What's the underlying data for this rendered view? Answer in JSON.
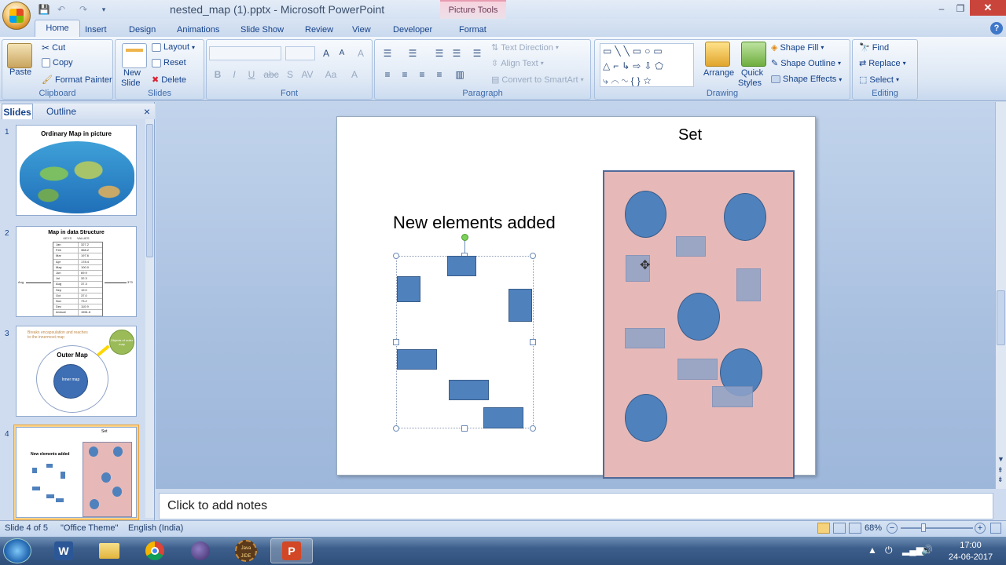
{
  "window": {
    "title": "nested_map (1).pptx - Microsoft PowerPoint",
    "context_tab": "Picture Tools",
    "min": "‒",
    "max": "❐",
    "close": "✕"
  },
  "tabs": [
    "Home",
    "Insert",
    "Design",
    "Animations",
    "Slide Show",
    "Review",
    "View",
    "Developer",
    "Format"
  ],
  "ribbon": {
    "clipboard": {
      "label": "Clipboard",
      "paste": "Paste",
      "cut": "Cut",
      "copy": "Copy",
      "format_painter": "Format Painter"
    },
    "slides": {
      "label": "Slides",
      "new_slide_1": "New",
      "new_slide_2": "Slide",
      "layout": "Layout",
      "reset": "Reset",
      "delete": "Delete"
    },
    "font": {
      "label": "Font",
      "bold": "B",
      "italic": "I",
      "underline": "U",
      "strike": "abc",
      "shadow": "S",
      "spacing": "AV",
      "case": "Aa",
      "grow": "A",
      "shrink": "A",
      "clear": "A"
    },
    "paragraph": {
      "label": "Paragraph",
      "text_direction": "Text Direction",
      "align_text": "Align Text",
      "convert": "Convert to SmartArt"
    },
    "drawing": {
      "label": "Drawing",
      "arrange": "Arrange",
      "quick_styles_1": "Quick",
      "quick_styles_2": "Styles",
      "shape_fill": "Shape Fill",
      "shape_outline": "Shape Outline",
      "shape_effects": "Shape Effects"
    },
    "editing": {
      "label": "Editing",
      "find": "Find",
      "replace": "Replace",
      "select": "Select"
    }
  },
  "panel": {
    "tab_slides": "Slides",
    "tab_outline": "Outline",
    "close": "×"
  },
  "thumbnails": [
    {
      "num": "1",
      "title": "Ordinary Map in picture"
    },
    {
      "num": "2",
      "title": "Map in data Structure",
      "cols": [
        "KEYS",
        "VALUES"
      ],
      "left_label": "Aug",
      "right_label": "373",
      "rows": [
        [
          "Jan",
          "327.2"
        ],
        [
          "Feb",
          "368.2"
        ],
        [
          "Mar",
          "197.6"
        ],
        [
          "Apr",
          "178.4"
        ],
        [
          "May",
          "100.0"
        ],
        [
          "Jun",
          "69.9"
        ],
        [
          "Jul",
          "32.3"
        ],
        [
          "Aug",
          "37.3"
        ],
        [
          "Sep",
          "19.0"
        ],
        [
          "Oct",
          "37.0"
        ],
        [
          "Nov",
          "73.2"
        ],
        [
          "Dec",
          "110.9"
        ],
        [
          "Annual",
          "1551.6"
        ]
      ]
    },
    {
      "num": "3",
      "caption": "Breaks encapsulation and reaches to the innermost map",
      "outer": "Outer Map",
      "inner": "Inner map",
      "bubble": "Objects of outer map"
    },
    {
      "num": "4",
      "title": "New elements added",
      "set": "Set"
    }
  ],
  "slide": {
    "heading_left": "New elements added",
    "heading_right": "Set"
  },
  "notes_placeholder": "Click to add notes",
  "status": {
    "slide": "Slide 4 of 5",
    "theme": "\"Office Theme\"",
    "language": "English (India)",
    "zoom": "68%"
  },
  "clock": {
    "time": "17:00",
    "date": "24-06-2017"
  },
  "taskbar": {
    "jide_1": "Java",
    "jide_2": "JIDE"
  },
  "colors": {
    "shape_fill": "#4f81bd",
    "set_fill": "#e6b9b8",
    "ribbon_text": "#15428b"
  }
}
